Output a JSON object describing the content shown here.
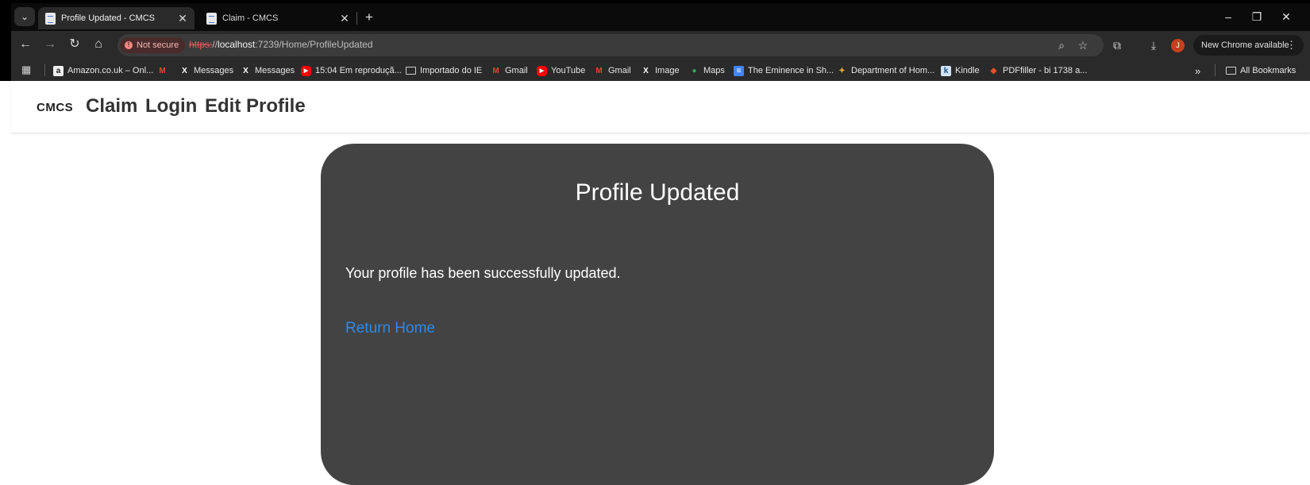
{
  "browser": {
    "tabs": [
      {
        "title": "Profile Updated - CMCS",
        "active": true
      },
      {
        "title": "Claim - CMCS",
        "active": false
      }
    ],
    "new_tab": "+",
    "window_controls": {
      "minimize": "–",
      "restore": "❐",
      "close": "✕"
    },
    "security_label": "Not secure",
    "url": {
      "scheme": "https:",
      "sep": "//",
      "host": "localhost",
      "path": ":7239/Home/ProfileUpdated"
    },
    "new_chrome_label": "New Chrome available",
    "profile_initial": "J",
    "bookmarks": [
      {
        "label": "Amazon.co.uk – Onl...",
        "icon": "amazon-icon"
      },
      {
        "label": "",
        "icon": "gmail-icon"
      },
      {
        "label": "Messages",
        "icon": "x-icon"
      },
      {
        "label": "Messages",
        "icon": "x-icon"
      },
      {
        "label": "15:04 Em reproduçã...",
        "icon": "youtube-icon"
      },
      {
        "label": "Importado do IE",
        "icon": "folder-icon"
      },
      {
        "label": "Gmail",
        "icon": "gmail-icon"
      },
      {
        "label": "YouTube",
        "icon": "youtube-icon"
      },
      {
        "label": "Gmail",
        "icon": "gmail-icon"
      },
      {
        "label": "Image",
        "icon": "x-icon"
      },
      {
        "label": "Maps",
        "icon": "maps-icon"
      },
      {
        "label": "The Eminence in Sh...",
        "icon": "doc-icon"
      },
      {
        "label": "Department of Hom...",
        "icon": "dhs-icon"
      },
      {
        "label": "Kindle",
        "icon": "kindle-icon"
      },
      {
        "label": "PDFfiller - bi 1738 a...",
        "icon": "pdffiller-icon"
      }
    ],
    "overflow": "»",
    "all_bookmarks": "All Bookmarks"
  },
  "site": {
    "brand": "CMCS",
    "nav": [
      "Claim",
      "Login",
      "Edit Profile"
    ]
  },
  "card": {
    "title": "Profile Updated",
    "message": "Your profile has been successfully updated.",
    "link": "Return Home"
  },
  "colors": {
    "card_bg": "#434343",
    "link": "#2f8ae8"
  }
}
